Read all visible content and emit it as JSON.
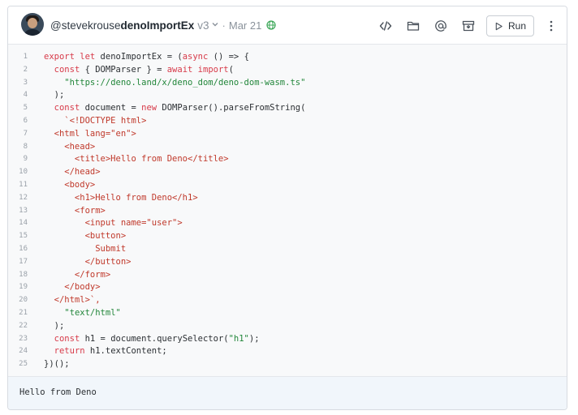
{
  "header": {
    "author": "@stevekrouse",
    "val_name": "denoImportEx",
    "version": "v3",
    "date": "Mar 21",
    "run_label": "Run",
    "icons": [
      "code-icon",
      "folder-icon",
      "at-icon",
      "archive-icon",
      "play-icon",
      "more-icon",
      "globe-icon",
      "chevron-down-icon"
    ],
    "accent": "#3aa657"
  },
  "code": {
    "lines": [
      {
        "n": "1",
        "text": "export let denoImportEx = (async () => {"
      },
      {
        "n": "2",
        "text": "  const { DOMParser } = await import("
      },
      {
        "n": "3",
        "text": "    \"https://deno.land/x/deno_dom/deno-dom-wasm.ts\""
      },
      {
        "n": "4",
        "text": "  );"
      },
      {
        "n": "5",
        "text": "  const document = new DOMParser().parseFromString("
      },
      {
        "n": "6",
        "text": "    `<!DOCTYPE html>"
      },
      {
        "n": "7",
        "text": "  <html lang=\"en\">"
      },
      {
        "n": "8",
        "text": "    <head>"
      },
      {
        "n": "9",
        "text": "      <title>Hello from Deno</title>"
      },
      {
        "n": "10",
        "text": "    </head>"
      },
      {
        "n": "11",
        "text": "    <body>"
      },
      {
        "n": "12",
        "text": "      <h1>Hello from Deno</h1>"
      },
      {
        "n": "13",
        "text": "      <form>"
      },
      {
        "n": "14",
        "text": "        <input name=\"user\">"
      },
      {
        "n": "15",
        "text": "        <button>"
      },
      {
        "n": "16",
        "text": "          Submit"
      },
      {
        "n": "17",
        "text": "        </button>"
      },
      {
        "n": "18",
        "text": "      </form>"
      },
      {
        "n": "19",
        "text": "    </body>"
      },
      {
        "n": "20",
        "text": "  </html>`,"
      },
      {
        "n": "21",
        "text": "    \"text/html\""
      },
      {
        "n": "22",
        "text": "  );"
      },
      {
        "n": "23",
        "text": "  const h1 = document.querySelector(\"h1\");"
      },
      {
        "n": "24",
        "text": "  return h1.textContent;"
      },
      {
        "n": "25",
        "text": "})();"
      }
    ]
  },
  "output": {
    "text": "Hello from Deno"
  }
}
